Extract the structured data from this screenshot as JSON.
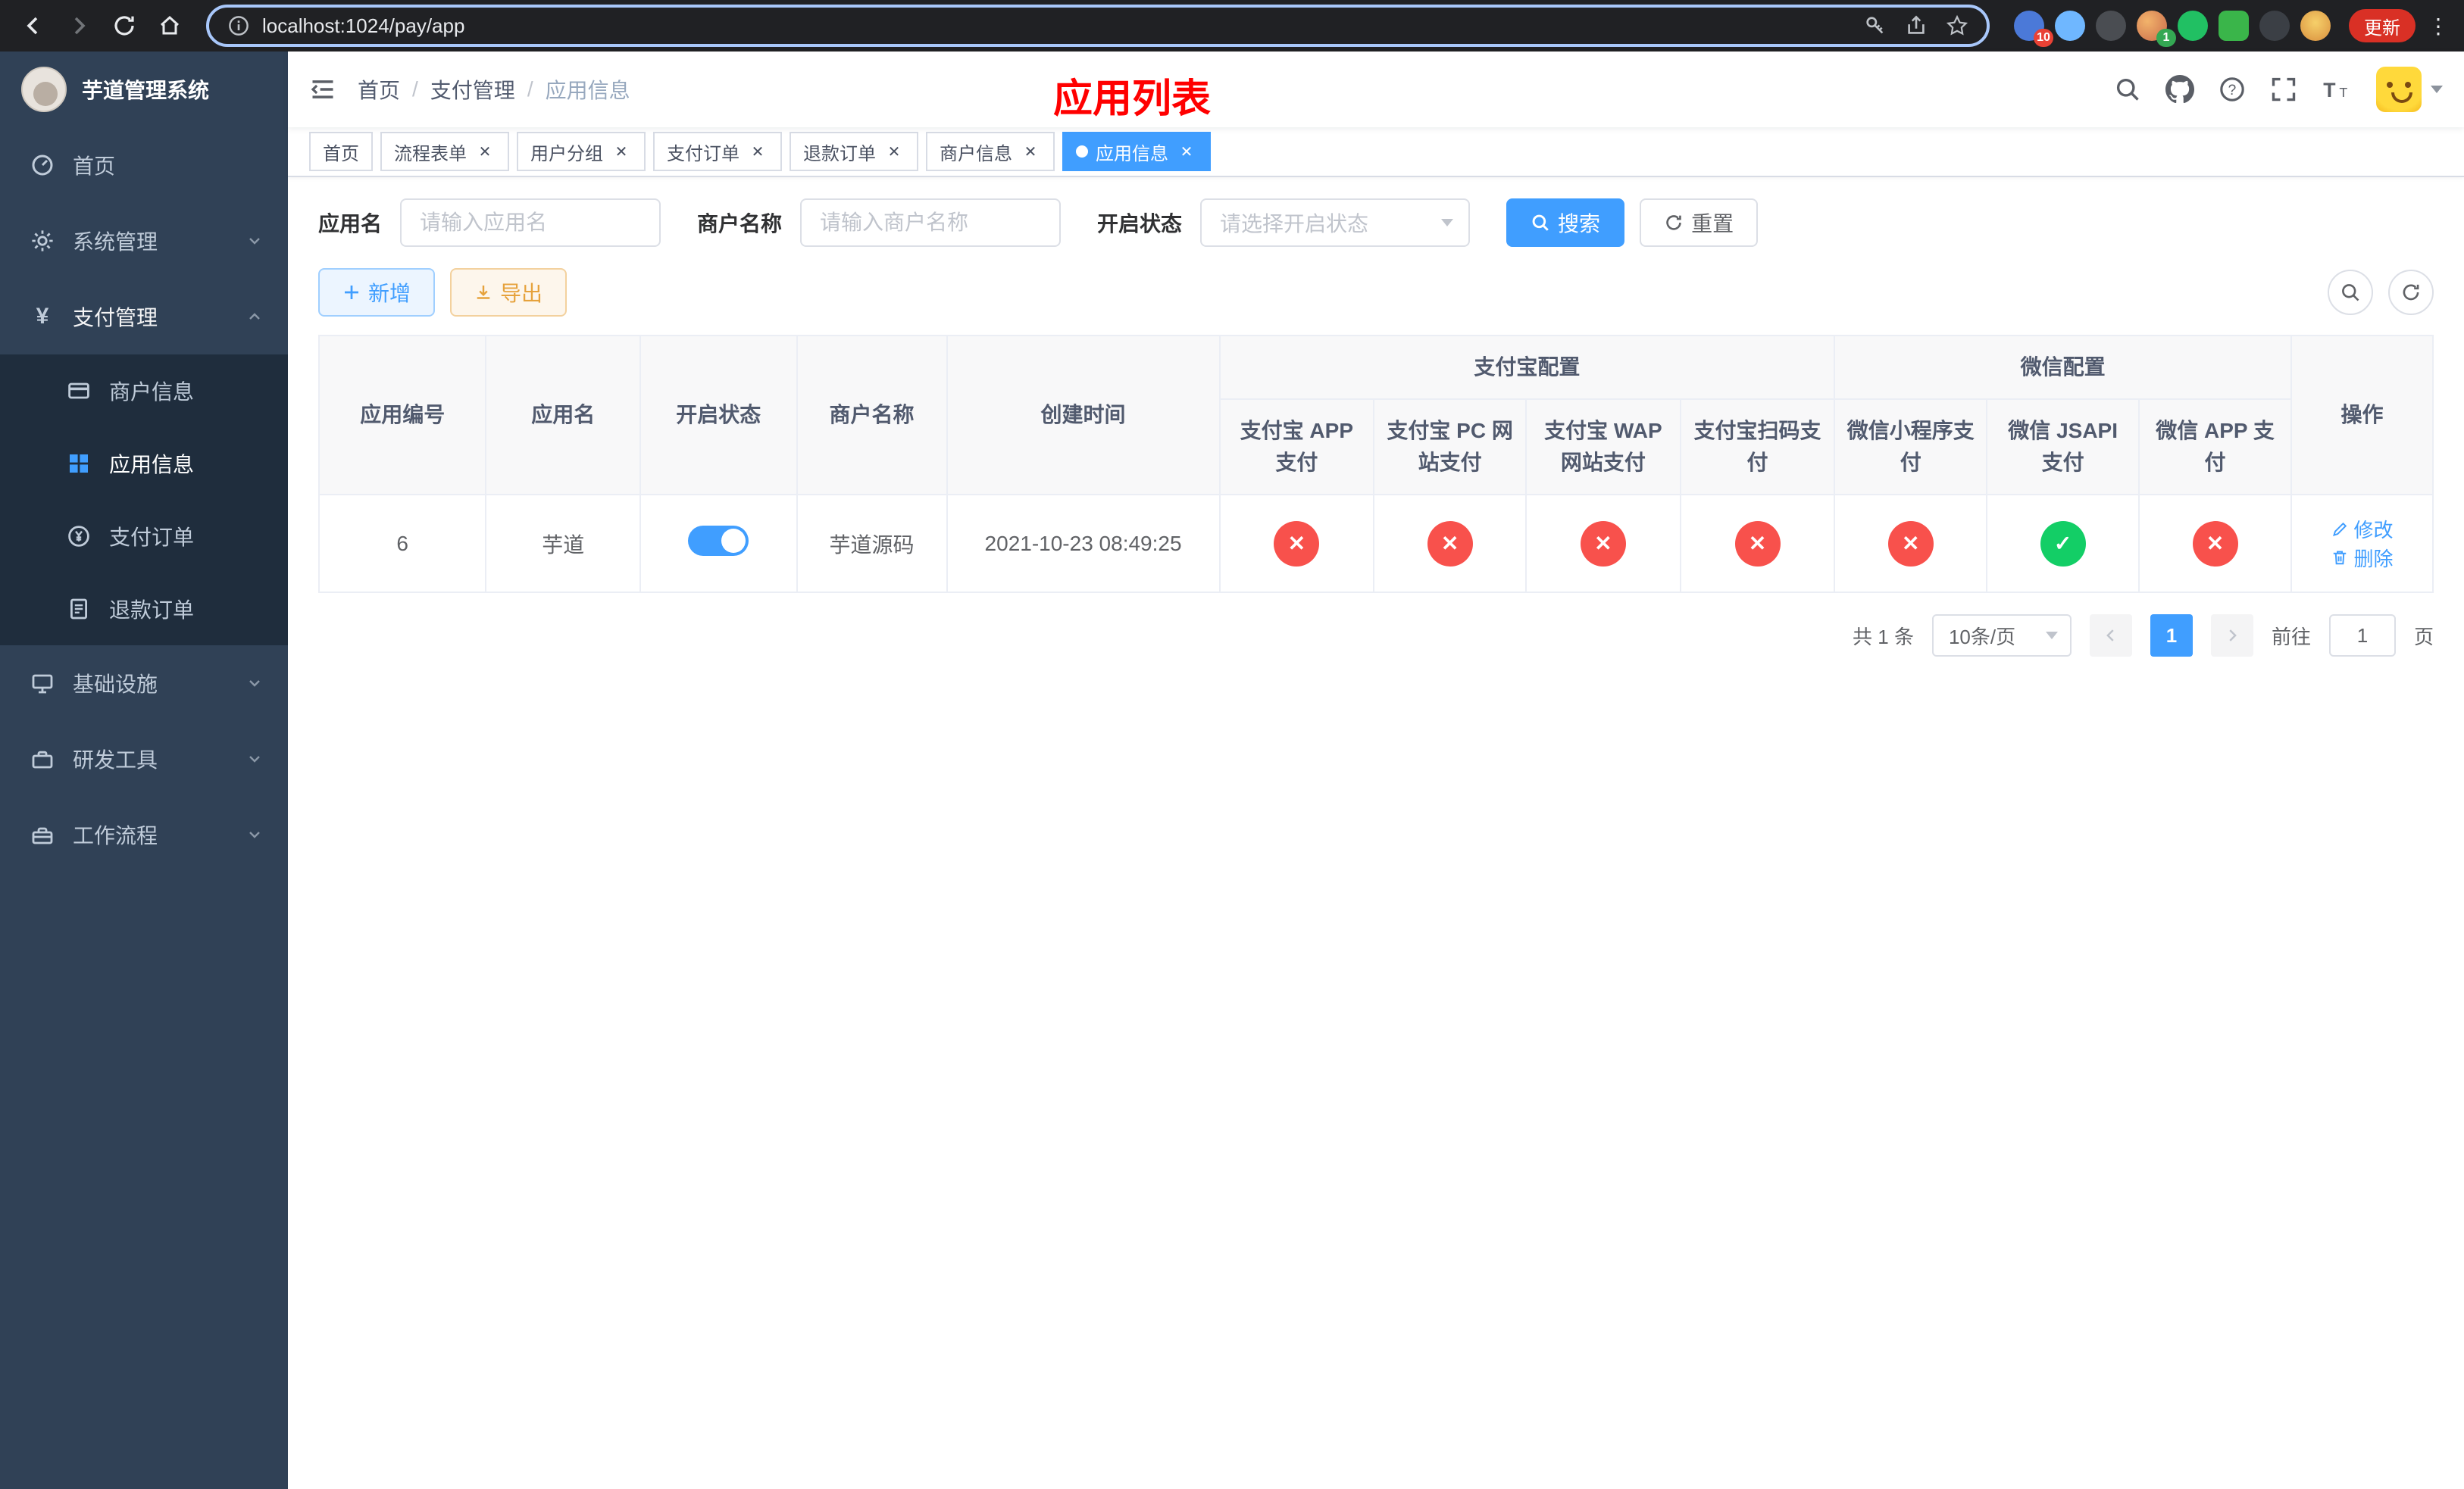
{
  "browser": {
    "url": "localhost:1024/pay/app",
    "update_label": "更新",
    "ext_badge_1": "10",
    "ext_badge_2": "1"
  },
  "sidebar": {
    "title": "芋道管理系统",
    "items": [
      {
        "label": "首页"
      },
      {
        "label": "系统管理"
      },
      {
        "label": "支付管理"
      },
      {
        "label": "商户信息"
      },
      {
        "label": "应用信息"
      },
      {
        "label": "支付订单"
      },
      {
        "label": "退款订单"
      },
      {
        "label": "基础设施"
      },
      {
        "label": "研发工具"
      },
      {
        "label": "工作流程"
      }
    ]
  },
  "header": {
    "breadcrumb": [
      "首页",
      "支付管理",
      "应用信息"
    ],
    "page_title": "应用列表"
  },
  "tabs": [
    {
      "label": "首页"
    },
    {
      "label": "流程表单"
    },
    {
      "label": "用户分组"
    },
    {
      "label": "支付订单"
    },
    {
      "label": "退款订单"
    },
    {
      "label": "商户信息"
    },
    {
      "label": "应用信息"
    }
  ],
  "filters": {
    "app_name_label": "应用名",
    "app_name_placeholder": "请输入应用名",
    "merchant_label": "商户名称",
    "merchant_placeholder": "请输入商户名称",
    "status_label": "开启状态",
    "status_placeholder": "请选择开启状态",
    "search_label": "搜索",
    "reset_label": "重置"
  },
  "toolbar": {
    "add_label": "新增",
    "export_label": "导出"
  },
  "table": {
    "groups": {
      "alipay": "支付宝配置",
      "wechat": "微信配置"
    },
    "columns": {
      "id": "应用编号",
      "name": "应用名",
      "status": "开启状态",
      "merchant": "商户名称",
      "created": "创建时间",
      "alipay_app": "支付宝 APP 支付",
      "alipay_pc": "支付宝 PC 网站支付",
      "alipay_wap": "支付宝 WAP 网站支付",
      "alipay_qr": "支付宝扫码支付",
      "wx_mini": "微信小程序支付",
      "wx_jsapi": "微信 JSAPI 支付",
      "wx_app": "微信 APP 支付",
      "actions": "操作"
    },
    "rows": [
      {
        "id": "6",
        "name": "芋道",
        "status": "on",
        "merchant": "芋道源码",
        "created": "2021-10-23 08:49:25",
        "configs": {
          "alipay_app": "fail",
          "alipay_pc": "fail",
          "alipay_wap": "fail",
          "alipay_qr": "fail",
          "wx_mini": "fail",
          "wx_jsapi": "success",
          "wx_app": "fail"
        },
        "edit_label": "修改",
        "delete_label": "删除"
      }
    ]
  },
  "pagination": {
    "total_text": "共 1 条",
    "page_size": "10条/页",
    "current_page": "1",
    "goto_prefix": "前往",
    "goto_value": "1",
    "goto_suffix": "页"
  }
}
